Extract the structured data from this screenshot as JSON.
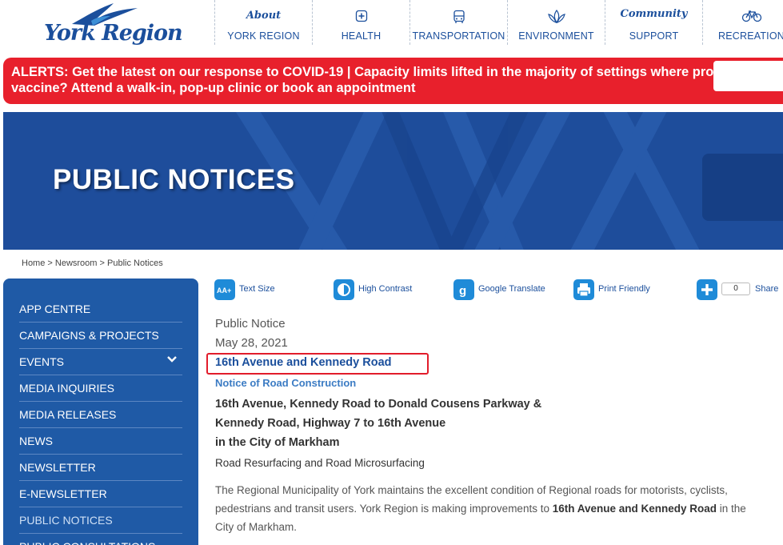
{
  "header": {
    "logo_text": "York Region",
    "nav": [
      {
        "top": "About",
        "label": "YORK REGION",
        "icon": "about-text"
      },
      {
        "top": "",
        "label": "HEALTH",
        "icon": "health-icon"
      },
      {
        "top": "",
        "label": "TRANSPORTATION",
        "icon": "bus-icon"
      },
      {
        "top": "",
        "label": "ENVIRONMENT",
        "icon": "leaf-icon"
      },
      {
        "top": "Community",
        "label": "SUPPORT",
        "icon": "community-text"
      },
      {
        "top": "",
        "label": "RECREATION",
        "icon": "bicycle-icon"
      }
    ]
  },
  "alert": {
    "line1": "ALERTS: Get the latest on our response to COVID-19 | Capacity limits lifted in the majority of settings where proof of vaccina",
    "line2": "vaccine? Attend a walk-in, pop-up clinic or book an appointment"
  },
  "banner": {
    "title": "PUBLIC NOTICES"
  },
  "breadcrumb": [
    "Home",
    "Newsroom",
    "Public Notices"
  ],
  "sidebar": {
    "items": [
      {
        "label": "APP CENTRE"
      },
      {
        "label": "CAMPAIGNS & PROJECTS"
      },
      {
        "label": "EVENTS"
      },
      {
        "label": "MEDIA INQUIRIES"
      },
      {
        "label": "MEDIA RELEASES"
      },
      {
        "label": "NEWS"
      },
      {
        "label": "NEWSLETTER"
      },
      {
        "label": "E-NEWSLETTER"
      },
      {
        "label": "PUBLIC NOTICES"
      },
      {
        "label": "PUBLIC CONSULTATIONS"
      }
    ]
  },
  "tools": {
    "text_size": "Text Size",
    "high_contrast": "High Contrast",
    "google_translate": "Google Translate",
    "print_friendly": "Print Friendly",
    "share_count": "0",
    "share": "Share"
  },
  "article": {
    "kicker": "Public Notice",
    "date": "May 28, 2021",
    "headline": "16th Avenue and Kennedy Road",
    "subhead": "Notice of Road Construction",
    "location_line1": "16th Avenue, Kennedy Road to Donald Cousens Parkway &",
    "location_line2": "Kennedy Road, Highway 7 to 16th Avenue",
    "location_line3": "in the City of Markham",
    "work_type": "Road Resurfacing and Road Microsurfacing",
    "body_part1": "The Regional Municipality of York maintains the excellent condition of Regional roads for motorists, cyclists, pedestrians and transit users. York Region is making improvements to ",
    "body_bold": "16th Avenue and Kennedy Road",
    "body_part2": " in the",
    "body_line3": "City of Markham."
  },
  "colors": {
    "brand_blue": "#1b4f9c",
    "alert_red": "#e8202c",
    "banner_blue": "#1e4d9b",
    "sidebar_blue": "#1f5aa6",
    "highlight_red": "#e21c2b"
  }
}
